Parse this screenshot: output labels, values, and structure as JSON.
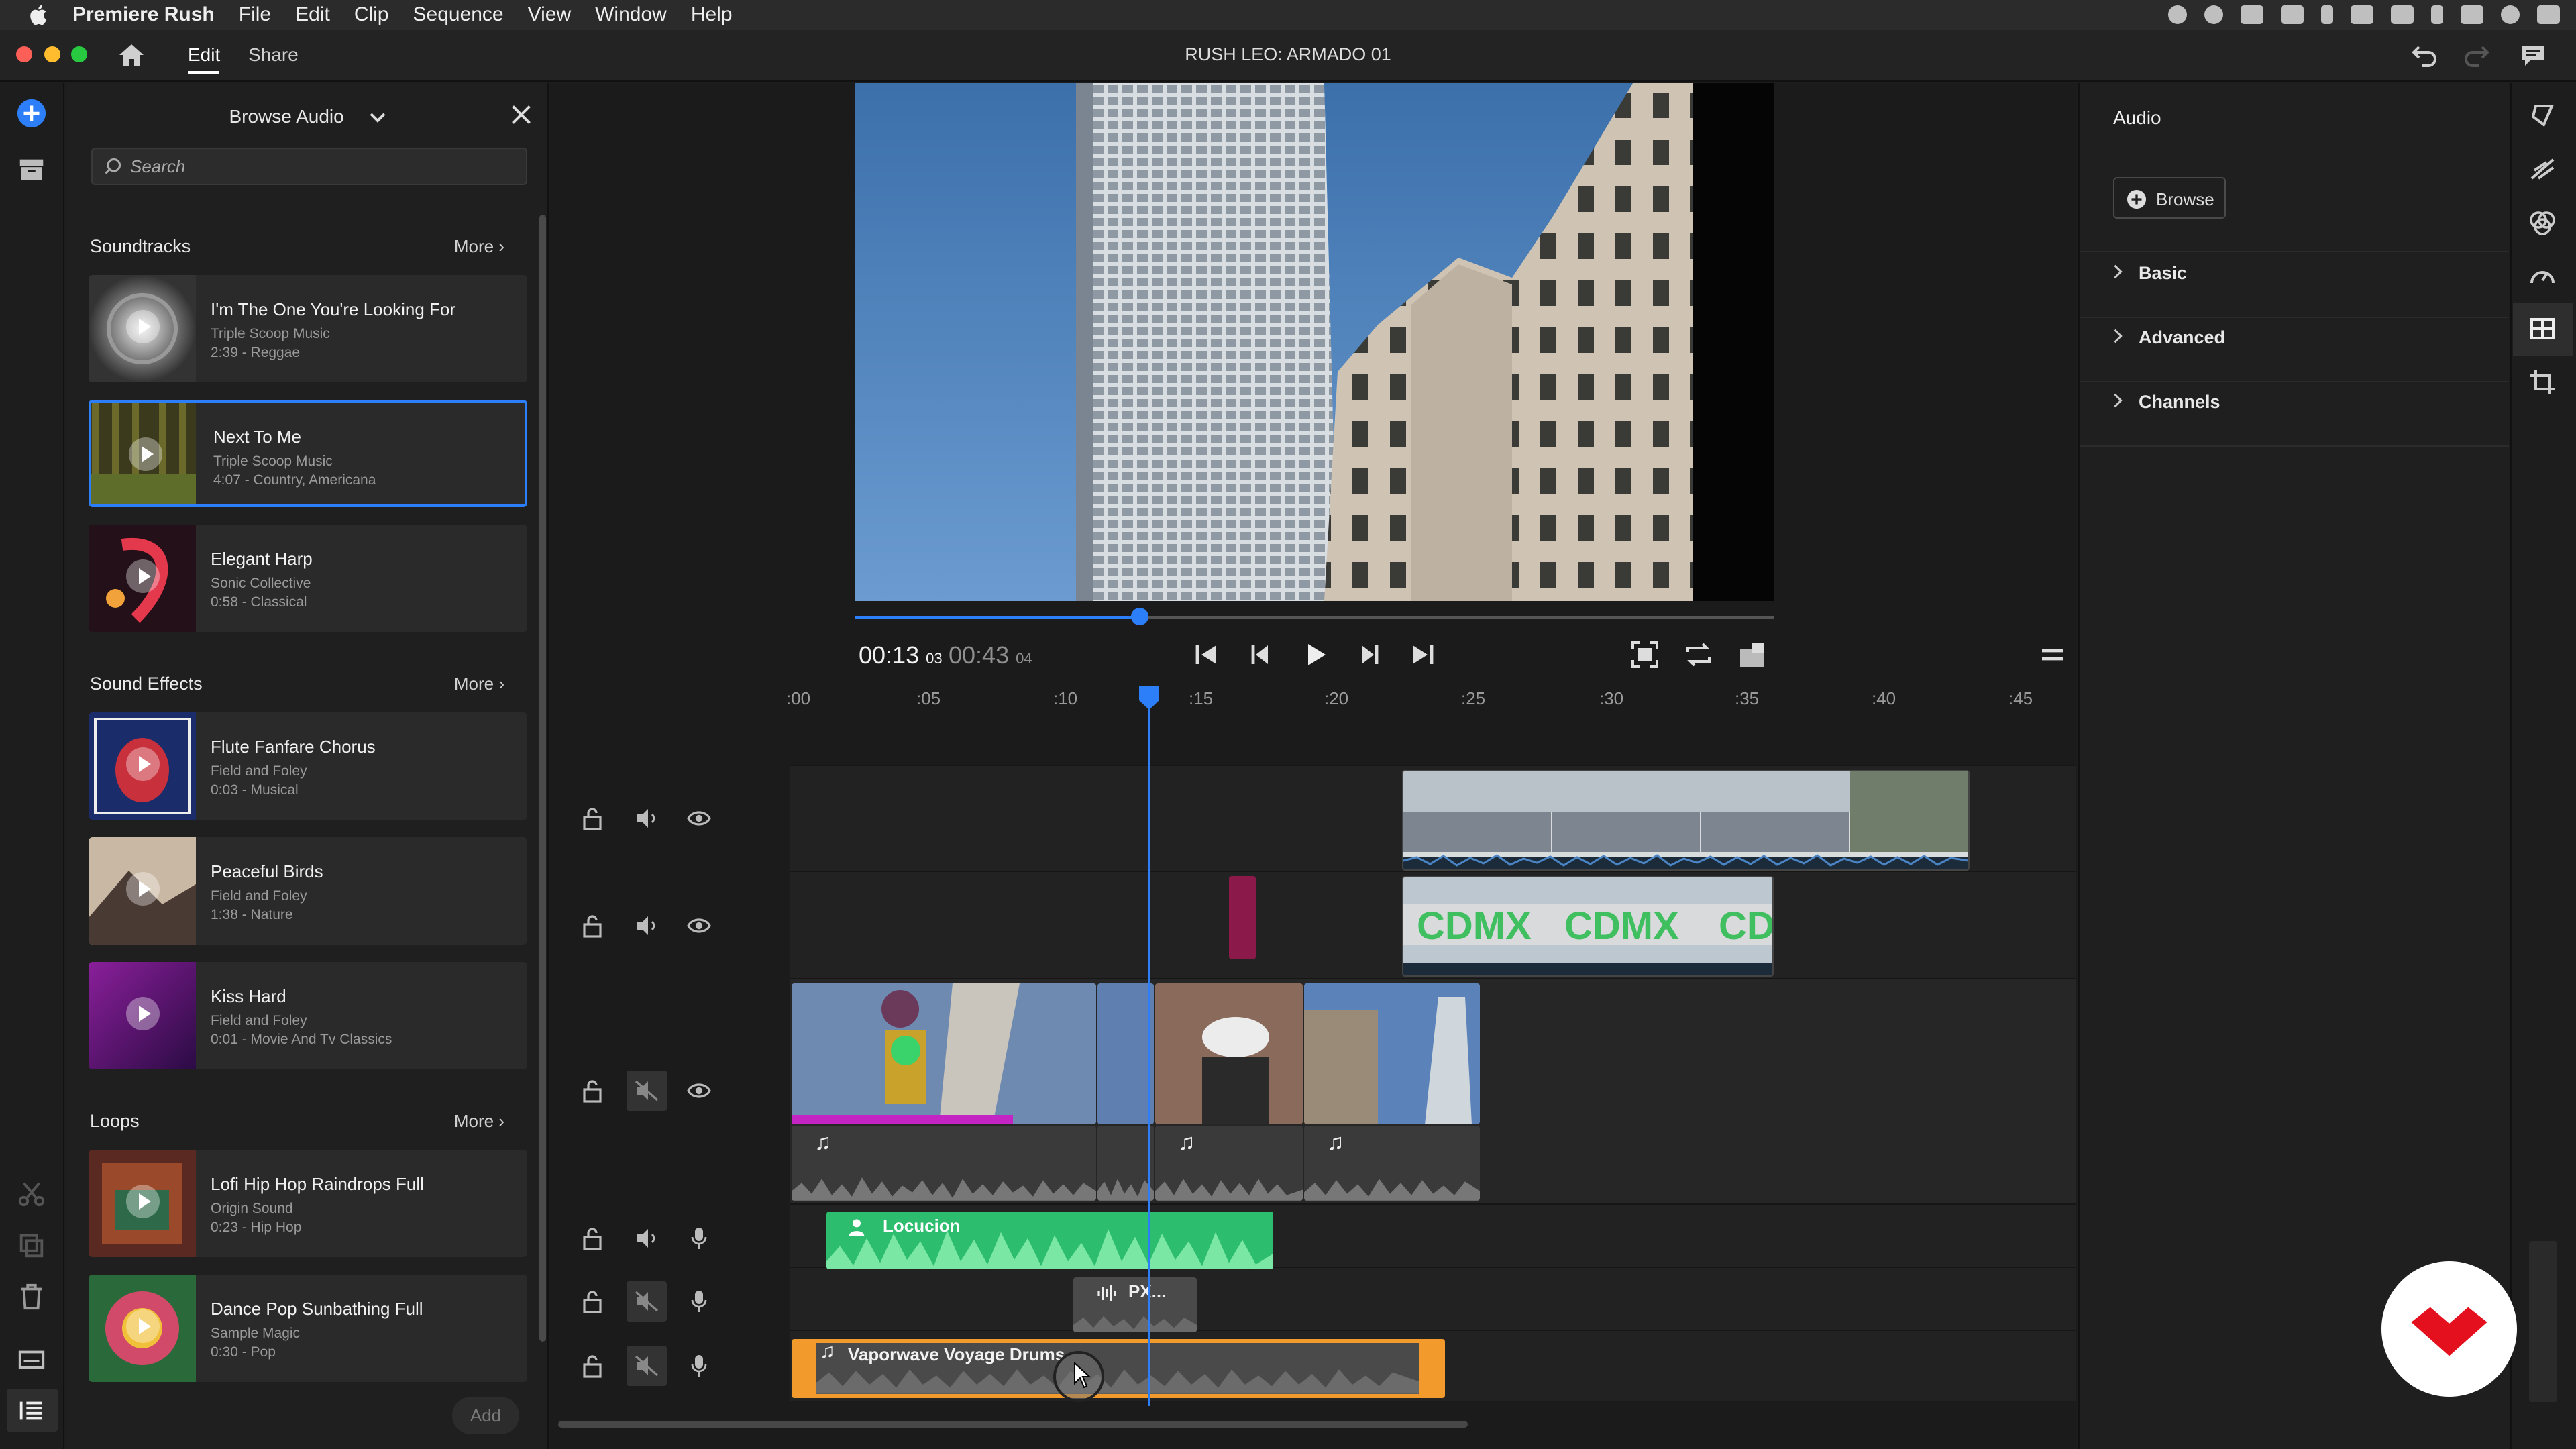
{
  "menubar": {
    "app_name": "Premiere Rush",
    "items": [
      "File",
      "Edit",
      "Clip",
      "Sequence",
      "View",
      "Window",
      "Help"
    ]
  },
  "titlebar": {
    "project_title": "RUSH LEO: ARMADO 01",
    "tabs": [
      {
        "label": "Edit",
        "active": true
      },
      {
        "label": "Share",
        "active": false
      }
    ]
  },
  "browse_panel": {
    "dropdown_label": "Browse Audio",
    "search_placeholder": "Search",
    "sections": [
      {
        "title": "Soundtracks",
        "more": "More",
        "items": [
          {
            "title": "I'm The One You're Looking For",
            "artist": "Triple Scoop Music",
            "meta": "2:39 - Reggae",
            "selected": false
          },
          {
            "title": "Next To Me",
            "artist": "Triple Scoop Music",
            "meta": "4:07 - Country, Americana",
            "selected": true
          },
          {
            "title": "Elegant Harp",
            "artist": "Sonic Collective",
            "meta": "0:58 - Classical",
            "selected": false
          }
        ]
      },
      {
        "title": "Sound Effects",
        "more": "More",
        "items": [
          {
            "title": "Flute Fanfare Chorus",
            "artist": "Field and Foley",
            "meta": "0:03 - Musical",
            "selected": false
          },
          {
            "title": "Peaceful Birds",
            "artist": "Field and Foley",
            "meta": "1:38 - Nature",
            "selected": false
          },
          {
            "title": "Kiss Hard",
            "artist": "Field and Foley",
            "meta": "0:01 - Movie And Tv Classics",
            "selected": false
          }
        ]
      },
      {
        "title": "Loops",
        "more": "More",
        "items": [
          {
            "title": "Lofi Hip Hop Raindrops Full",
            "artist": "Origin Sound",
            "meta": "0:23 - Hip Hop",
            "selected": false
          },
          {
            "title": "Dance Pop Sunbathing Full",
            "artist": "Sample Magic",
            "meta": "0:30 - Pop",
            "selected": false
          }
        ]
      }
    ],
    "add_label": "Add"
  },
  "viewer": {
    "current_time": "00:13",
    "current_frames": "03",
    "duration": "00:43",
    "duration_frames": "04",
    "progress": 0.31
  },
  "timeline": {
    "ruler_ticks": [
      ":00",
      ":05",
      ":10",
      ":15",
      ":20",
      ":25",
      ":30",
      ":35",
      ":40",
      ":45"
    ],
    "clips": {
      "voiceover": "Locucion",
      "fx_short": "PX...",
      "music": "Vaporwave Voyage Drums"
    }
  },
  "audio_panel": {
    "title": "Audio",
    "browse_label": "Browse",
    "sections": [
      "Basic",
      "Advanced",
      "Channels"
    ]
  },
  "colors": {
    "accent": "#2d7ff9",
    "voice_clip": "#2dbd6e",
    "music_clip": "#f39a2c",
    "selection_bar": "#c424c4"
  }
}
